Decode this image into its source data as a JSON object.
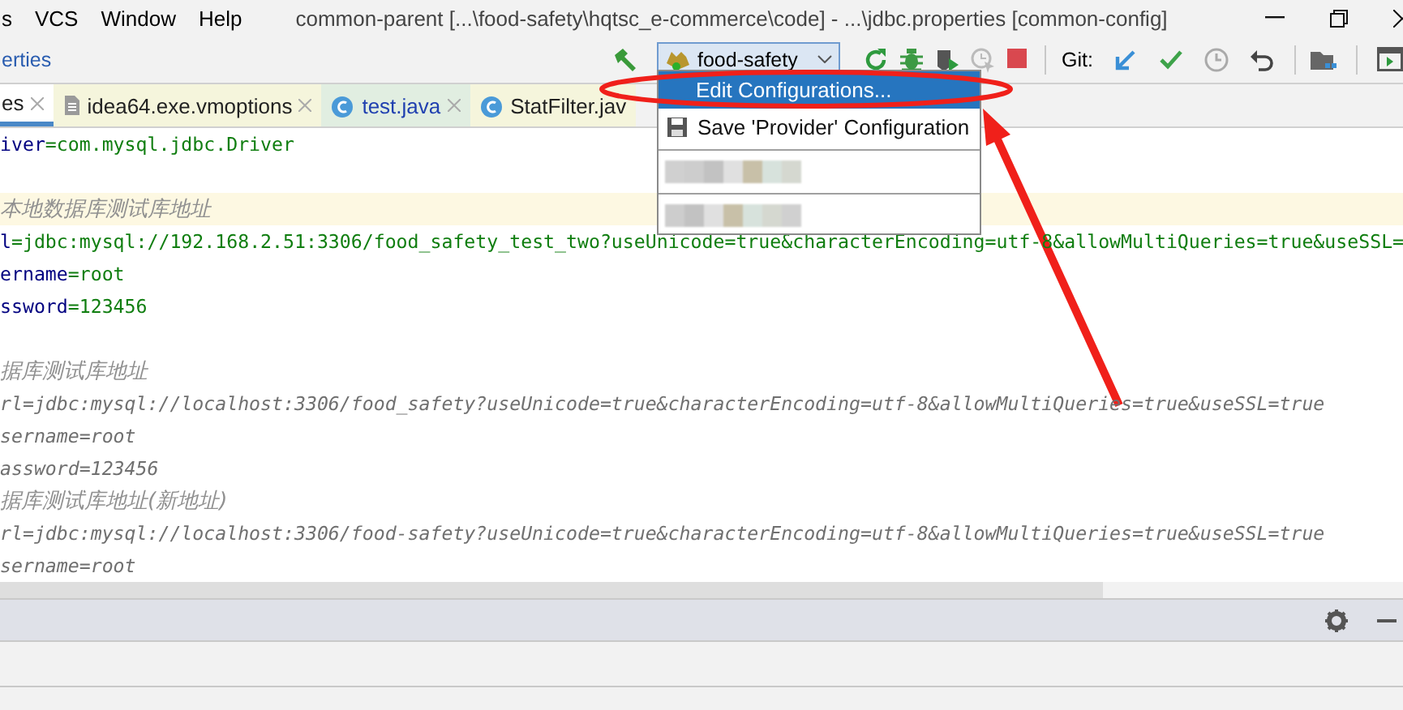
{
  "window": {
    "title": "common-parent [...\\food-safety\\hqtsc_e-commerce\\code] - ...\\jdbc.properties [common-config]"
  },
  "menu": [
    "s",
    "VCS",
    "Window",
    "Help"
  ],
  "breadcrumb": "erties",
  "run_config": {
    "label": "food-safety",
    "expanded": true
  },
  "git_label": "Git:",
  "tabs": [
    {
      "label": "es",
      "kind": "cut",
      "selected": true
    },
    {
      "label": "idea64.exe.vmoptions",
      "kind": "file",
      "selected": false
    },
    {
      "label": "test.java",
      "kind": "class",
      "selected": false
    },
    {
      "label": "StatFilter.jav",
      "kind": "class",
      "selected": false
    }
  ],
  "popup": {
    "items": [
      {
        "kind": "action",
        "label": "Edit Configurations...",
        "selected": true
      },
      {
        "kind": "save",
        "label": "Save 'Provider' Configuration",
        "selected": false
      },
      {
        "kind": "redacted",
        "selected": false
      },
      {
        "kind": "redacted",
        "selected": false
      }
    ]
  },
  "editor": {
    "lines": [
      {
        "kind": "property",
        "key": "iver",
        "value": "=com.mysql.jdbc.Driver",
        "current": false
      },
      {
        "kind": "blank",
        "current": false
      },
      {
        "kind": "comment",
        "text": "本地数据库测试库地址",
        "current": true
      },
      {
        "kind": "property",
        "key": "l",
        "value": "=jdbc:mysql://192.168.2.51:3306/food_safety_test_two?useUnicode=true&characterEncoding=utf-8&allowMultiQueries=true&useSSL=",
        "current": false
      },
      {
        "kind": "property",
        "key": "ername",
        "value": "=root",
        "current": false
      },
      {
        "kind": "property",
        "key": "ssword",
        "value": "=123456",
        "current": false
      },
      {
        "kind": "blank",
        "current": false
      },
      {
        "kind": "comment",
        "text": "据库测试库地址",
        "current": false
      },
      {
        "kind": "commented",
        "text": "rl=jdbc:mysql://localhost:3306/food_safety?useUnicode=true&characterEncoding=utf-8&allowMultiQueries=true&useSSL=true",
        "current": false
      },
      {
        "kind": "commented",
        "text": "sername=root",
        "current": false
      },
      {
        "kind": "commented",
        "text": "assword=123456",
        "current": false
      },
      {
        "kind": "comment",
        "text": "据库测试库地址(新地址)",
        "current": false
      },
      {
        "kind": "commented",
        "text": "rl=jdbc:mysql://localhost:3306/food-safety?useUnicode=true&characterEncoding=utf-8&allowMultiQueries=true&useSSL=true",
        "current": false
      },
      {
        "kind": "commented",
        "text": "sername=root",
        "current": false
      }
    ]
  }
}
